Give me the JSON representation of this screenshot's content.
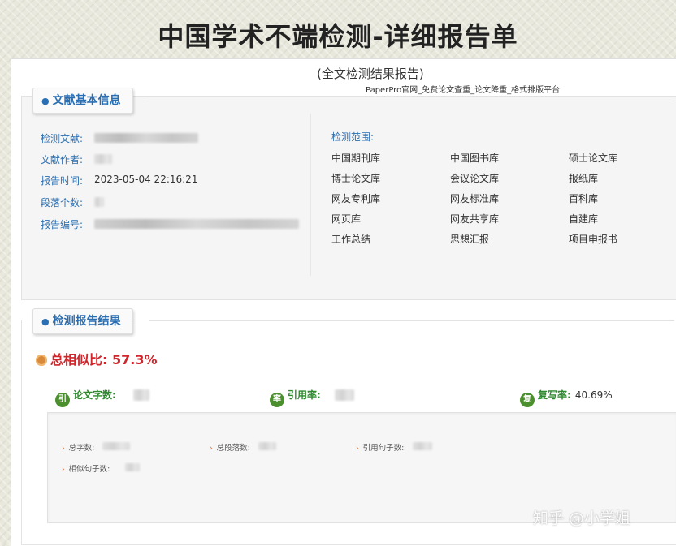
{
  "header": {
    "title": "中国学术不端检测-详细报告单",
    "subtitle": "(全文检测结果报告)",
    "platform": "PaperPro官网_免费论文查重_论文降重_格式排版平台"
  },
  "basic_info": {
    "section_title": "文献基本信息",
    "fields": [
      {
        "label": "检测文献:",
        "value": ""
      },
      {
        "label": "文献作者:",
        "value": ""
      },
      {
        "label": "报告时间:",
        "value": "2023-05-04 22:16:21"
      },
      {
        "label": "段落个数:",
        "value": ""
      },
      {
        "label": "报告编号:",
        "value": ""
      }
    ],
    "scope_label": "检测范围:",
    "databases": [
      "中国期刊库",
      "中国图书库",
      "硕士论文库",
      "博士论文库",
      "会议论文库",
      "报纸库",
      "网友专利库",
      "网友标准库",
      "百科库",
      "网页库",
      "网友共享库",
      "自建库",
      "工作总结",
      "思想汇报",
      "项目申报书"
    ]
  },
  "results": {
    "section_title": "检测报告结果",
    "total_similarity": "总相似比: 57.3%",
    "stats": [
      {
        "icon_char": "引",
        "label": "论文字数:",
        "value": ""
      },
      {
        "icon_char": "率",
        "label": "引用率:",
        "value": ""
      },
      {
        "icon_char": "复",
        "label": "复写率:",
        "value": "40.69%"
      }
    ],
    "details": [
      {
        "label": "总字数:",
        "value": ""
      },
      {
        "label": "总段落数:",
        "value": ""
      },
      {
        "label": "引用句子数:",
        "value": ""
      },
      {
        "label": "相似句子数:",
        "value": ""
      }
    ]
  },
  "watermark": "知乎 @小学姐"
}
